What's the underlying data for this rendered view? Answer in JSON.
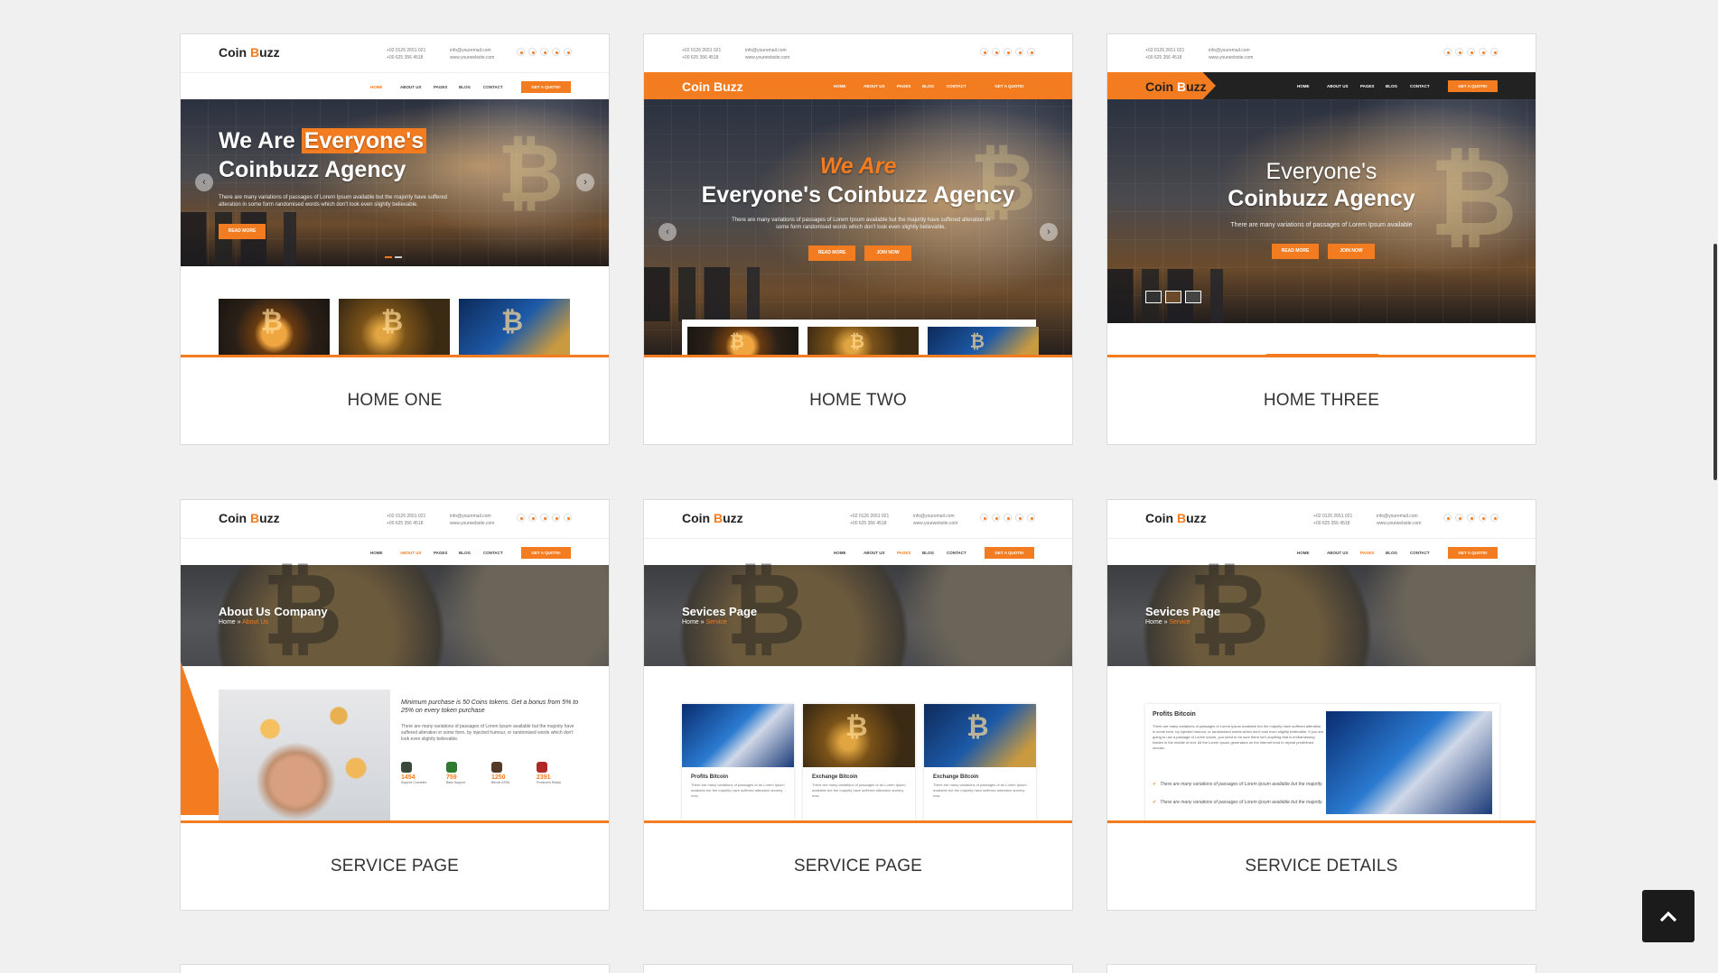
{
  "cards": [
    {
      "title": "HOME ONE"
    },
    {
      "title": "HOME TWO"
    },
    {
      "title": "HOME THREE"
    },
    {
      "title": "SERVICE PAGE"
    },
    {
      "title": "SERVICE PAGE"
    },
    {
      "title": "SERVICE DETAILS"
    }
  ],
  "preview": {
    "logo_a": "Coin ",
    "logo_b": "B",
    "logo_c": "uzz",
    "phone": "+02 0126 2651 021",
    "phone2": "+00 625 356 4518",
    "email": "info@youremail.com",
    "web": "www.yourwebsite.com",
    "nav": [
      "HOME",
      "ABOUT US",
      "PAGES",
      "BLOG",
      "CONTACT"
    ],
    "quote_button": "GET A QUOTE!",
    "read_more": "READ MORE",
    "join_now": "JOIN NOW",
    "hero_desc": "There are many variations of passages of Lorem Ipsum available but the majority have suffered alteration in some form randomised words which don't look even slightly believable.",
    "hero_desc3": "There are many variations of passages of Lorem Ipsum available",
    "home1": {
      "line1_a": "We Are ",
      "line1_b": "Everyone's",
      "line2": "Coinbuzz Agency"
    },
    "home2": {
      "line1": "We Are",
      "line2": "Everyone's Coinbuzz Agency"
    },
    "home3": {
      "line1": "Everyone's",
      "line2": "Coinbuzz Agency"
    },
    "about": {
      "title": "About Us Company",
      "crumb_home": "Home » ",
      "crumb_cur": "About Us",
      "heading": "Minimum purchase is 50 Coins tokens. Get a bonus from 5% to 25% on every token purchase",
      "body": "There are many variations of passages of Lorem Ipsum available but the majority have suffered alteration in some form, by injected humour, or randomised words which don't look even slightly believable.",
      "stats": [
        {
          "n": "1454",
          "l": "Support Countries"
        },
        {
          "n": "759",
          "l": "Bank Support"
        },
        {
          "n": "1250",
          "l": "Bitcoin ATMs"
        },
        {
          "n": "2391",
          "l": "Producers Ready"
        }
      ]
    },
    "services": {
      "title": "Sevices Page",
      "crumb_home": "Home » ",
      "crumb_cur": "Service",
      "items": [
        {
          "h": "Profits Bitcoin",
          "t": "There are many variations of passages of an Lorem Ipsum available but the majority have suffered alteration dummy now."
        },
        {
          "h": "Exchange Bitcoin",
          "t": "There are many variations of passages of an Lorem Ipsum available but the majority have suffered alteration dummy now."
        },
        {
          "h": "Exchange Bitcoin",
          "t": "There are many variations of passages of an Lorem Ipsum available but the majority have suffered alteration dummy now."
        }
      ]
    },
    "details": {
      "heading": "Profits Bitcoin",
      "body": "There are many variations of passages of Lorem Ipsum available but the majority have suffered alteration in some form, by injected humour, or randomised words which don't look even slightly believable. If you are going to use a passage of Lorem Ipsum, you need to be sure there isn't anything that is embarrassing hidden in the middle of text. All the Lorem Ipsum generators on the internet tend to repeat predefined chunks.",
      "checks": [
        "There are many variations of passages of Lorem Ipsum available but the majority.",
        "There are many variations of passages of Lorem Ipsum available but the majority."
      ]
    }
  },
  "accent_color": "#f47c20",
  "scroll_top_icon": "chevron-up-icon"
}
